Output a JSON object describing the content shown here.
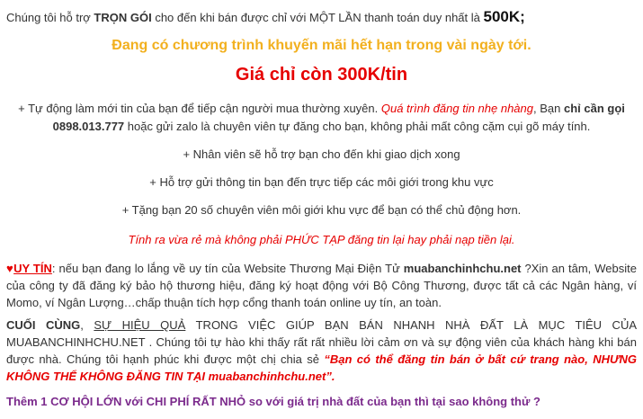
{
  "line1": {
    "prefix": "Chúng tôi hỗ trợ ",
    "tron_goi": "TRỌN GÓI",
    "middle": " cho đến khi bán được chỉ với ",
    "mot_lan": "MỘT LẦN",
    "suffix": " thanh toán duy nhất là ",
    "price": "500K;"
  },
  "promo": "Đang có chương trình khuyến mãi hết hạn trong vài ngày tới.",
  "price_line": "Giá chỉ còn 300K/tin",
  "bullet1": {
    "a": "+ Tự động làm mới tin của bạn để tiếp cận người mua thường xuyên. ",
    "b": "Quá trình đăng tin nhẹ nhàng",
    "c": ", Bạn ",
    "d": "chỉ cần gọi",
    "phone": "0898.013.777",
    "e": " hoặc gửi zalo là chuyên viên tự đăng cho bạn, không phải mất công cặm cụi gõ máy tính."
  },
  "bullet2": "+ Nhân viên sẽ hỗ trợ bạn cho đến khi giao dịch xong",
  "bullet3": "+ Hỗ trợ gửi thông tin bạn đến trực tiếp các môi giới trong khu vực",
  "bullet4": "+ Tặng bạn 20 số chuyên viên môi giới khu vực để bạn có thể chủ động hơn.",
  "note": "Tính ra vừa rẻ mà không phải PHỨC TẠP đăng tin lại hay phải nạp tiền lại.",
  "uytin": {
    "heart": "♥",
    "label": "UY TÍN",
    "a": ": nếu bạn đang lo lắng về uy tín của Website Thương Mại Điện Tử ",
    "site": "muabanchinhchu.net",
    "b": " ?Xin an tâm, Website của công ty đã đăng ký bảo hộ thương hiệu, đăng ký hoạt động với Bộ Công Thương, được tất cả các Ngân hàng, ví Momo, ví Ngân Lượng…chấp thuận tích hợp cổng thanh toán online uy tín, an toàn."
  },
  "final": {
    "label": "CUỐI CÙNG",
    "comma": ", ",
    "underlined": "SỰ HIỆU QUẢ",
    "a": " TRONG VIỆC GIÚP BẠN BÁN NHANH NHÀ ĐẤT LÀ MỤC TIÊU CỦA MUABANCHINHCHU.NET . Chúng tôi tự hào khi thấy rất rất nhiều lời cảm ơn và sự động viên của khách hàng khi bán được nhà. Chúng tôi hạnh phúc khi được một chị chia sẻ ",
    "quote": "“Bạn có thể đăng tin bán ở bất cứ trang nào, NHƯNG KHÔNG THỂ KHÔNG ĐĂNG TIN TẠI muabanchinhchu.net”."
  },
  "last": "Thêm 1 CƠ HỘI LỚN với CHI PHÍ RẤT NHỎ so với giá trị nhà đất của bạn thì tại sao không thử ?",
  "colors": {
    "promo": "#f2b01e",
    "red": "#e60000",
    "purple": "#7b2a8c"
  }
}
